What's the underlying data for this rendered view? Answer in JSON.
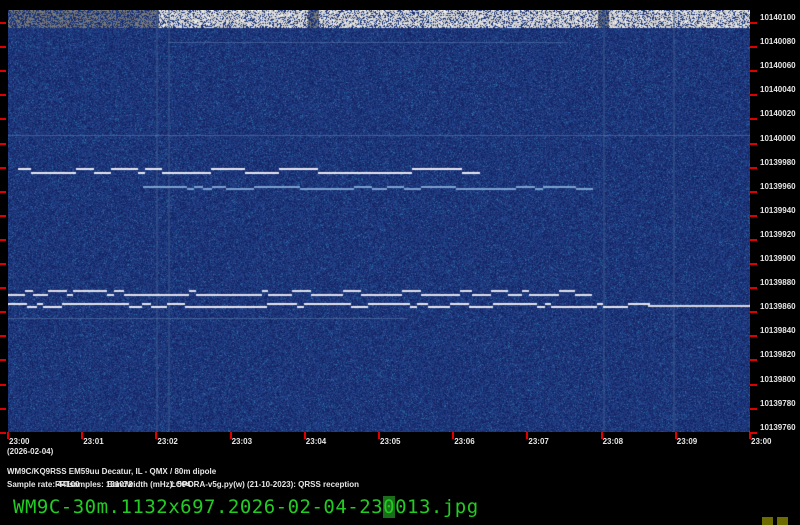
{
  "waterfall": {
    "freq_labels": [
      "10140100",
      "10140080",
      "10140060",
      "10140040",
      "10140020",
      "10140000",
      "10139980",
      "10139960",
      "10139940",
      "10139920",
      "10139900",
      "10139880",
      "10139860",
      "10139840",
      "10139820",
      "10139800",
      "10139780",
      "10139760"
    ],
    "time_labels": [
      "23:00",
      "23:01",
      "23:02",
      "23:03",
      "23:04",
      "23:05",
      "23:06",
      "23:07",
      "23:08",
      "23:09",
      "23:00"
    ],
    "date": "(2026-02-04)",
    "background_color": "#14246a"
  },
  "info": {
    "station": "WM9C/KQ9RSS EM59uu Decatur, IL - QMX / 80m dipole",
    "sample_rate": "Sample rate: 44100",
    "fft_samples": "FFTsamples: 131072",
    "bandwidth": "Bandwidth (mHz): 504",
    "software": "LOPORA-v5g.py(w) (21-10-2023): QRSS reception"
  },
  "filename": {
    "prefix": "WM9C-30m.1132x697.2026-02-04-23",
    "highlight": "0",
    "suffix": "013.jpg"
  }
}
